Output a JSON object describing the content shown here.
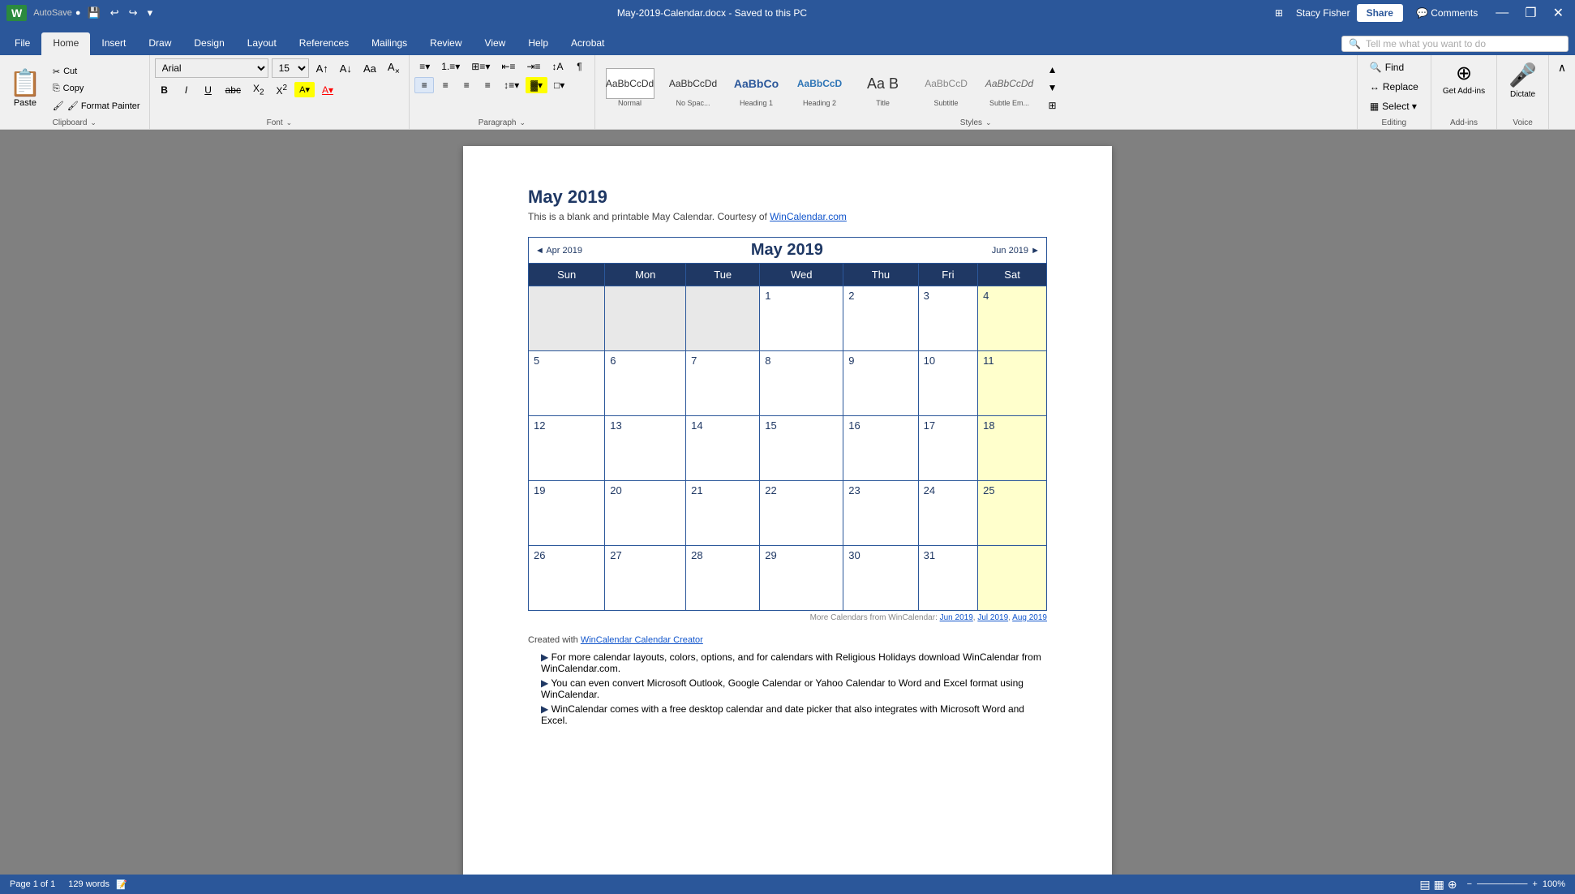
{
  "titlebar": {
    "filename": "May-2019-Calendar.docx",
    "save_status": "Saved to this PC",
    "full_title": "May-2019-Calendar.docx - Saved to this PC",
    "user": "Stacy Fisher",
    "app_icon": "W",
    "min_btn": "—",
    "restore_btn": "❐",
    "close_btn": "✕"
  },
  "quickaccess": {
    "save": "💾",
    "undo": "↩",
    "redo": "↪",
    "customize": "▾"
  },
  "tabs": [
    "File",
    "Home",
    "Insert",
    "Draw",
    "Design",
    "Layout",
    "References",
    "Mailings",
    "Review",
    "View",
    "Help",
    "Acrobat"
  ],
  "ribbon": {
    "clipboard": {
      "label": "Clipboard",
      "paste": "Paste",
      "cut": "✂ Cut",
      "copy": "⎘ Copy",
      "format_painter": "🖌 Format Painter"
    },
    "font": {
      "label": "Font",
      "face": "Arial",
      "size": "15",
      "grow": "A↑",
      "shrink": "A↓",
      "case": "Aa",
      "clear": "A✕",
      "bold": "B",
      "italic": "I",
      "underline": "U",
      "strikethrough": "abc",
      "subscript": "X₂",
      "superscript": "X²",
      "color": "A"
    },
    "paragraph": {
      "label": "Paragraph"
    },
    "styles": {
      "label": "Styles",
      "items": [
        {
          "name": "Normal",
          "preview": "AaBbCcDd"
        },
        {
          "name": "No Spac...",
          "preview": "AaBbCcDd"
        },
        {
          "name": "Heading 1",
          "preview": "AaBbCo"
        },
        {
          "name": "Heading 2",
          "preview": "AaBbCcD"
        },
        {
          "name": "Title",
          "preview": "Aa B"
        },
        {
          "name": "Subtitle",
          "preview": "AaBbCcD"
        },
        {
          "name": "Subtle Em...",
          "preview": "AaBbCcDd"
        }
      ]
    },
    "editing": {
      "label": "Editing",
      "find": "Find",
      "replace": "Replace",
      "select": "Select ▾"
    },
    "addins": {
      "label": "Add-ins",
      "get_addins": "Get Add-ins"
    },
    "voice": {
      "label": "Voice",
      "dictate": "Dictate"
    }
  },
  "search": {
    "placeholder": "Tell me what you want to do"
  },
  "document": {
    "title": "May 2019",
    "subtitle": "This is a blank and printable May Calendar.  Courtesy of ",
    "subtitle_link": "WinCalendar.com",
    "calendar": {
      "month_year": "May  2019",
      "prev_nav": "◄ Apr 2019",
      "next_nav": "Jun 2019 ►",
      "headers": [
        "Sun",
        "Mon",
        "Tue",
        "Wed",
        "Thu",
        "Fri",
        "Sat"
      ],
      "weeks": [
        [
          {
            "day": "",
            "empty": true
          },
          {
            "day": "",
            "empty": true
          },
          {
            "day": "",
            "empty": true
          },
          {
            "day": "1",
            "weekend": false
          },
          {
            "day": "2",
            "weekend": false
          },
          {
            "day": "3",
            "weekend": false
          },
          {
            "day": "4",
            "weekend": true
          }
        ],
        [
          {
            "day": "5",
            "weekend": false
          },
          {
            "day": "6",
            "weekend": false
          },
          {
            "day": "7",
            "weekend": false
          },
          {
            "day": "8",
            "weekend": false
          },
          {
            "day": "9",
            "weekend": false
          },
          {
            "day": "10",
            "weekend": false
          },
          {
            "day": "11",
            "weekend": true
          }
        ],
        [
          {
            "day": "12",
            "weekend": false
          },
          {
            "day": "13",
            "weekend": false
          },
          {
            "day": "14",
            "weekend": false
          },
          {
            "day": "15",
            "weekend": false
          },
          {
            "day": "16",
            "weekend": false
          },
          {
            "day": "17",
            "weekend": false
          },
          {
            "day": "18",
            "weekend": true
          }
        ],
        [
          {
            "day": "19",
            "weekend": false
          },
          {
            "day": "20",
            "weekend": false
          },
          {
            "day": "21",
            "weekend": false
          },
          {
            "day": "22",
            "weekend": false
          },
          {
            "day": "23",
            "weekend": false
          },
          {
            "day": "24",
            "weekend": false
          },
          {
            "day": "25",
            "weekend": true
          }
        ],
        [
          {
            "day": "26",
            "weekend": false
          },
          {
            "day": "27",
            "weekend": false
          },
          {
            "day": "28",
            "weekend": false
          },
          {
            "day": "29",
            "weekend": false
          },
          {
            "day": "30",
            "weekend": false
          },
          {
            "day": "31",
            "weekend": false
          },
          {
            "day": "",
            "weekend": true,
            "empty_end": true
          }
        ]
      ],
      "footer": "More Calendars from WinCalendar: ",
      "footer_links": [
        "Jun 2019",
        "Jul 2019",
        "Aug 2019"
      ]
    },
    "created_with": "Created with ",
    "creator_link": "WinCalendar Calendar Creator",
    "bullets": [
      "For more calendar layouts, colors, options, and for calendars with Religious Holidays download WinCalendar from WinCalendar.com.",
      "You can even convert Microsoft Outlook, Google Calendar or Yahoo Calendar to Word and Excel format using WinCalendar.",
      "WinCalendar comes with a free desktop calendar and date picker that also integrates with Microsoft Word and Excel."
    ]
  },
  "statusbar": {
    "page": "Page 1 of 1",
    "words": "129 words",
    "view_normal": "☰",
    "view_layout": "▦",
    "view_web": "⊕",
    "zoom": "100%"
  }
}
